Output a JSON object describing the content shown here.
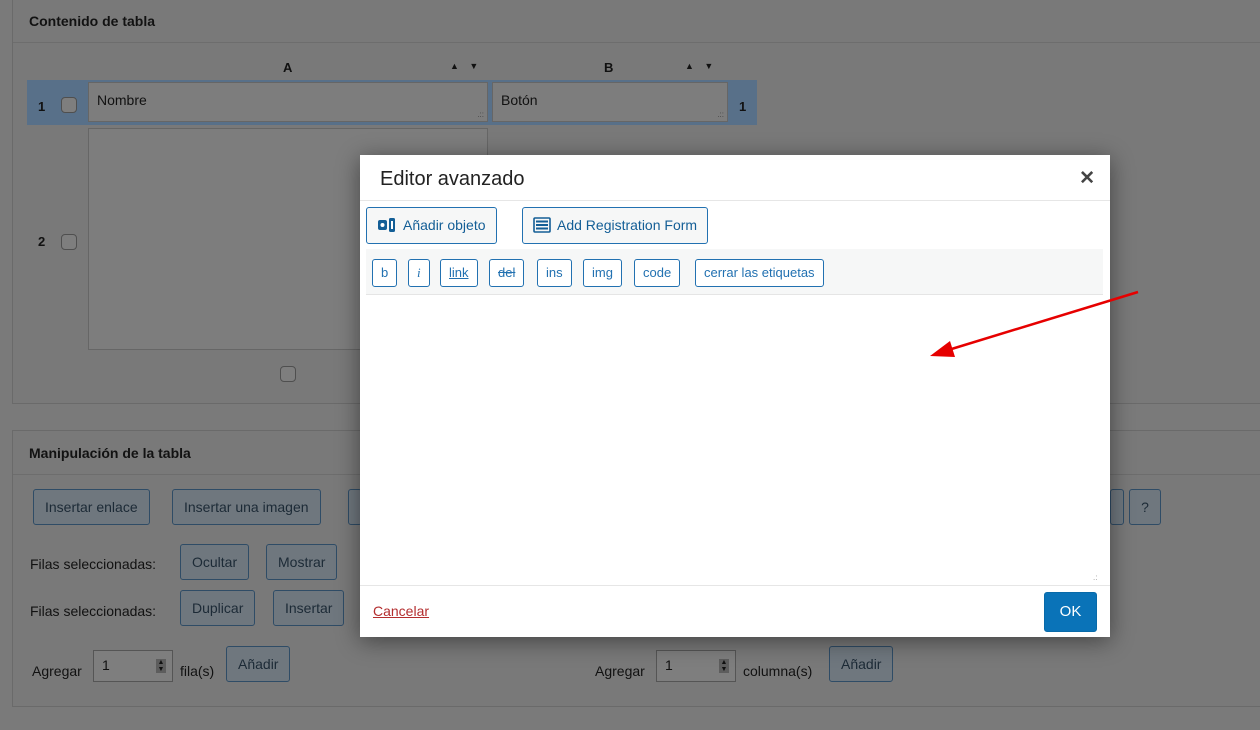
{
  "content_panel": {
    "title": "Contenido de tabla",
    "columns": [
      {
        "letter": "A",
        "arrows": "▲ ▼"
      },
      {
        "letter": "B",
        "arrows": "▲ ▼"
      }
    ],
    "rows": [
      {
        "number": "1",
        "number_right": "1",
        "cells": [
          "Nombre",
          "Botón"
        ]
      },
      {
        "number": "2",
        "cells": [
          ""
        ]
      }
    ]
  },
  "manip_panel": {
    "title": "Manipulación de la tabla",
    "toolbar": {
      "insert_link": "Insertar enlace",
      "insert_image": "Insertar una imagen",
      "help": "?"
    },
    "selected_rows_label_1": "Filas seleccionadas:",
    "hide": "Ocultar",
    "show": "Mostrar",
    "selected_rows_label_2": "Filas seleccionadas:",
    "duplicate": "Duplicar",
    "insert": "Insertar",
    "add_rows": {
      "prefix": "Agregar",
      "value": "1",
      "suffix": "fila(s)",
      "button": "Añadir"
    },
    "add_cols": {
      "prefix": "Agregar",
      "value": "1",
      "suffix": "columna(s)",
      "button": "Añadir"
    }
  },
  "modal": {
    "title": "Editor avanzado",
    "close_icon": "close-icon",
    "add_object": "Añadir objeto",
    "add_registration_form": "Add Registration Form",
    "quicktags": {
      "b": "b",
      "i": "i",
      "link": "link",
      "del": "del",
      "ins": "ins",
      "img": "img",
      "code": "code",
      "close_tags": "cerrar las etiquetas"
    },
    "editor_value": "",
    "cancel": "Cancelar",
    "ok": "OK"
  },
  "colors": {
    "accent": "#2271b1",
    "ok_button": "#0a73b8",
    "cancel_link": "#b32d2e",
    "annotation_arrow": "#e60000",
    "overlay_page": "#7a7a7a"
  }
}
